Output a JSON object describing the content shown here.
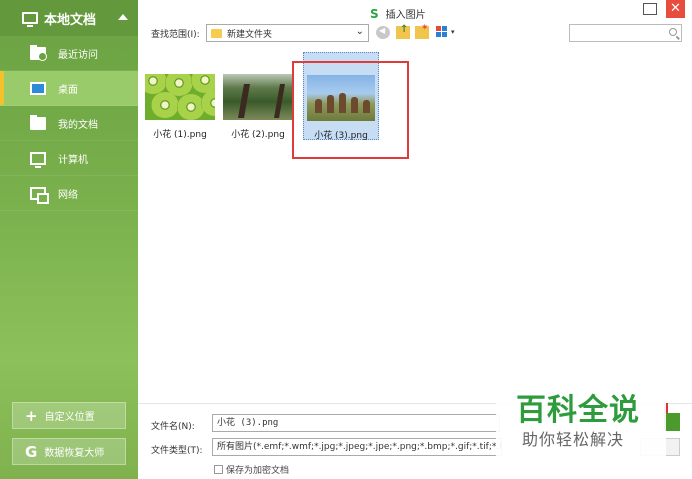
{
  "window": {
    "title": "插入图片",
    "title_logo": "S",
    "close_glyph": "✕"
  },
  "sidebar": {
    "header": "本地文档",
    "items": [
      {
        "label": "最近访问",
        "icon": "recent-folder-icon",
        "active": false
      },
      {
        "label": "桌面",
        "icon": "desktop-icon",
        "active": true
      },
      {
        "label": "我的文档",
        "icon": "documents-folder-icon",
        "active": false
      },
      {
        "label": "计算机",
        "icon": "computer-icon",
        "active": false
      },
      {
        "label": "网络",
        "icon": "network-icon",
        "active": false
      }
    ],
    "custom_location_button": "自定义位置",
    "custom_location_glyph": "+",
    "recovery_button": "数据恢复大师",
    "recovery_glyph": "G"
  },
  "toolbar": {
    "look_in_label": "查找范围(I):",
    "look_in_value": "新建文件夹",
    "look_in_chevron": "⌄",
    "view_menu_glyph": "▾"
  },
  "files": [
    {
      "name": "小花 (1).png",
      "thumb": "kiwi-slices",
      "selected": false
    },
    {
      "name": "小花 (2).png",
      "thumb": "tree-landscape",
      "selected": false
    },
    {
      "name": "小花 (3).png",
      "thumb": "statues-field",
      "selected": true
    }
  ],
  "bottom": {
    "file_name_label": "文件名(N):",
    "file_name_value": "小花 (3).png",
    "file_type_label": "文件类型(T):",
    "file_type_value": "所有图片(*.emf;*.wmf;*.jpg;*.jpeg;*.jpe;*.png;*.bmp;*.gif;*.tif;*.tiff;*.wd",
    "encrypt_label": "保存为加密文档",
    "encrypt_checked": false
  },
  "watermark": {
    "title": "百科全说",
    "subtitle": "助你轻松解决"
  },
  "colors": {
    "sidebar_green": "#6aa142",
    "active_item": "#9acb6a",
    "selection_blue": "#c6ddf3",
    "highlight_red": "#de3b3b",
    "watermark_green": "#2e9b3d"
  }
}
